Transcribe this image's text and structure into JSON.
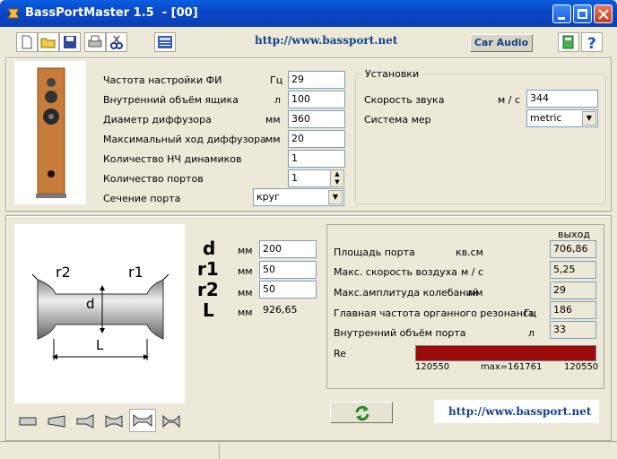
{
  "window": {
    "title": "BassPortMaster 1.5  - [00]"
  },
  "toolbar": {
    "url": "http://www.bassport.net",
    "car_audio": "Car Audio",
    "icons": [
      "new-file-icon",
      "open-folder-icon",
      "save-icon",
      "print-icon",
      "cut-icon",
      "calculator-icon",
      "exit-icon",
      "help-icon"
    ]
  },
  "params": {
    "rows": [
      {
        "label": "Частота настройки ФИ",
        "unit": "Гц",
        "value": "29"
      },
      {
        "label": "Внутренний объём ящика",
        "unit": "л",
        "value": "100"
      },
      {
        "label": "Диаметр диффузора",
        "unit": "мм",
        "value": "360"
      },
      {
        "label": "Максимальный ход диффузора",
        "unit": "мм",
        "value": "20"
      },
      {
        "label": "Количество НЧ динамиков",
        "unit": "",
        "value": "1"
      },
      {
        "label": "Количество портов",
        "unit": "",
        "value": "1"
      }
    ],
    "port_section_label": "Сечение порта",
    "port_section_value": "круг"
  },
  "settings": {
    "title": "Установки",
    "sound_speed_label": "Скорость звука",
    "sound_speed_unit": "м / с",
    "sound_speed_value": "344",
    "measure_label": "Система мер",
    "measure_value": "metric"
  },
  "dimensions": {
    "rows": [
      {
        "name": "d",
        "unit": "мм",
        "value": "200"
      },
      {
        "name": "r1",
        "unit": "мм",
        "value": "50"
      },
      {
        "name": "r2",
        "unit": "мм",
        "value": "50"
      },
      {
        "name": "L",
        "unit": "мм",
        "value": "926,65"
      }
    ],
    "diagram_labels": {
      "r2": "r2",
      "r1": "r1",
      "d": "d",
      "L": "L"
    }
  },
  "output": {
    "header": "выход",
    "rows": [
      {
        "label": "Площадь порта",
        "unit": "кв.см",
        "value": "706,86"
      },
      {
        "label": "Макс. скорость воздуха",
        "unit": "м / с",
        "value": "5,25"
      },
      {
        "label": "Макс.амплитуда колебаний",
        "unit": "мм",
        "value": "29"
      },
      {
        "label": "Главная частота органного резонанса",
        "unit": "Гц",
        "value": "186"
      },
      {
        "label": "Внутренний объём порта",
        "unit": "л",
        "value": "33"
      }
    ],
    "re_label": "Re",
    "re_left": "120550",
    "re_max": "max=161761",
    "re_right": "120550",
    "re_fill_fraction": 1.0,
    "re_color": "#9b0b0b"
  },
  "bottom": {
    "url": "http://www.bassport.net",
    "shape_icons": [
      "straight-port-icon",
      "cone-port-icon",
      "horn-port-icon",
      "double-flare-icon",
      "flared-both-ends-icon",
      "narrow-flare-icon"
    ]
  }
}
